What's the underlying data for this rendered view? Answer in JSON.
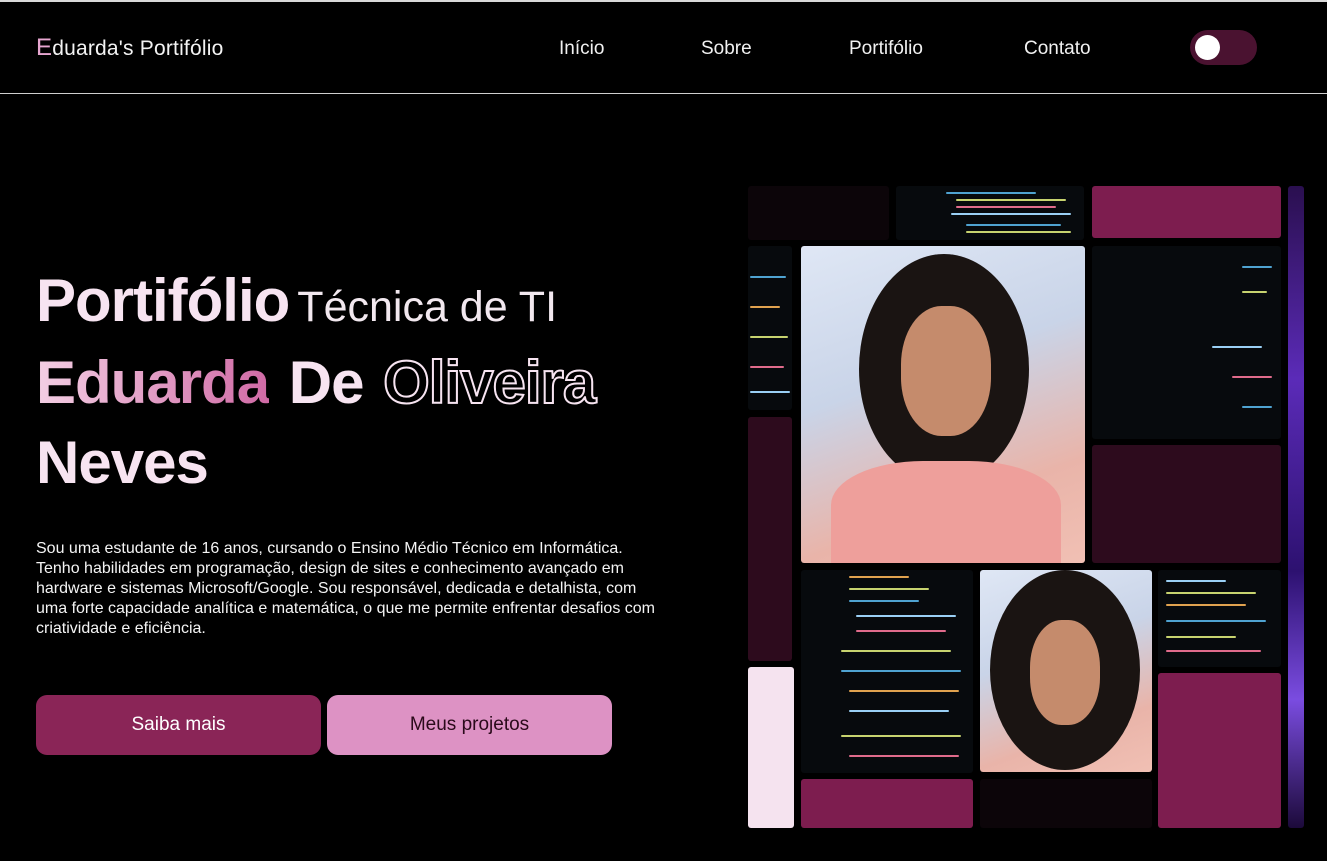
{
  "header": {
    "brand_initial": "E",
    "brand_rest": "duarda's Portifólio",
    "nav": [
      {
        "label": "Início"
      },
      {
        "label": "Sobre"
      },
      {
        "label": "Portifólio"
      },
      {
        "label": "Contato"
      }
    ],
    "theme_toggle": {
      "state": "on"
    }
  },
  "hero": {
    "title_big": "Portifólio",
    "title_sub": "Técnica de TI",
    "name_gradient": "Eduarda",
    "name_plain": "De",
    "name_outline": "Oliveira",
    "name_last": "Neves",
    "description": "Sou uma estudante de 16 anos, cursando o Ensino Médio Técnico em Informática. Tenho habilidades em programação, design de sites e conhecimento avançado em hardware e sistemas Microsoft/Google. Sou responsável, dedicada e detalhista, com uma forte capacidade analítica e matemática, o que me permite enfrentar desafios com criatividade e eficiência.",
    "buttons": {
      "primary": "Saiba mais",
      "secondary": "Meus projetos"
    }
  },
  "colors": {
    "accent_dark": "#8a2557",
    "accent_light": "#dd92c4",
    "tile_maroon": "#7d1d4f",
    "tile_dark_maroon": "#2d0b1d",
    "tile_pale": "#f5e3ef"
  }
}
